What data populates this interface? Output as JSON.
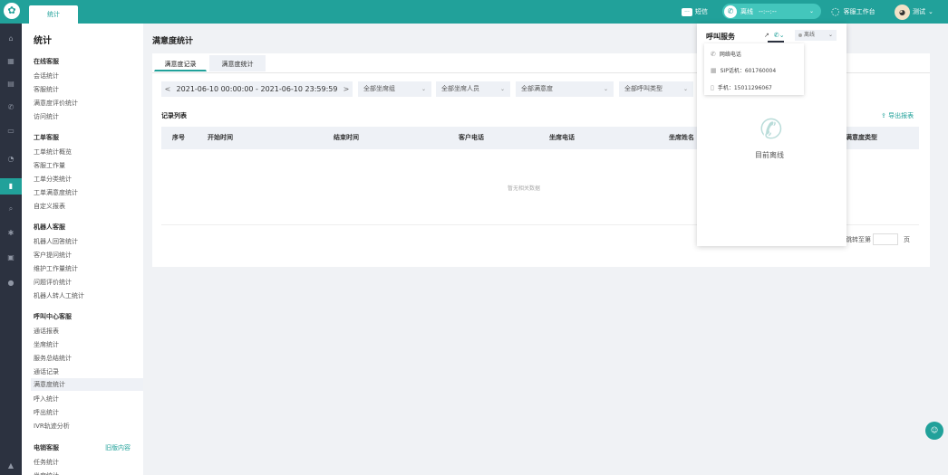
{
  "topbar": {
    "logo_glyph": "✿",
    "tab_label": "统计",
    "sms_label": "短信",
    "call_status": {
      "label": "离线",
      "timer": "--:--:--",
      "arrow": "⌄"
    },
    "workbench_label": "客服工作台",
    "user_name": "测试",
    "user_arrow": "⌄"
  },
  "rail": {
    "icons": [
      {
        "name": "home-icon",
        "glyph": "⌂"
      },
      {
        "name": "grid-icon",
        "glyph": "▦"
      },
      {
        "name": "file-icon",
        "glyph": "▤"
      },
      {
        "name": "phone-icon",
        "glyph": "✆"
      },
      {
        "name": "message-icon",
        "glyph": "▭"
      },
      {
        "name": "user-icon",
        "glyph": "◔"
      },
      {
        "name": "chart-icon",
        "glyph": "▮"
      },
      {
        "name": "search-icon",
        "glyph": "⌕"
      },
      {
        "name": "gear-icon",
        "glyph": "✱"
      },
      {
        "name": "mail-icon",
        "glyph": "▣"
      },
      {
        "name": "info-icon",
        "glyph": "●"
      },
      {
        "name": "bell-icon",
        "glyph": "▲"
      }
    ]
  },
  "nav": {
    "title": "统计",
    "groups": [
      {
        "label": "在线客服",
        "items": [
          "会话统计",
          "客服统计",
          "满意度评价统计",
          "访问统计"
        ]
      },
      {
        "label": "工单客服",
        "items": [
          "工单统计概览",
          "客服工作量",
          "工单分类统计",
          "工单满意度统计",
          "自定义报表"
        ]
      },
      {
        "label": "机器人客服",
        "items": [
          "机器人回答统计",
          "客户提问统计",
          "维护工作量统计",
          "问题评价统计",
          "机器人转人工统计"
        ]
      },
      {
        "label": "呼叫中心客服",
        "items": [
          "通话报表",
          "坐席统计",
          "服务总结统计",
          "通话记录",
          "满意度统计",
          "呼入统计",
          "呼出统计",
          "IVR轨迹分析"
        ]
      },
      {
        "label": "电销客服",
        "extra": "旧版内容",
        "items": [
          "任务统计",
          "坐席统计"
        ]
      }
    ],
    "active_item": "满意度统计"
  },
  "main": {
    "page_title": "满意度统计",
    "tabs": [
      "满意度记录",
      "满意度统计"
    ],
    "filters": {
      "date_range": "2021-06-10 00:00:00 - 2021-06-10 23:59:59",
      "prev": "<",
      "next": ">",
      "selects": [
        "全部坐席组",
        "全部坐席人员",
        "全部满意度",
        "全部呼叫类型"
      ]
    },
    "list_title": "记录列表",
    "export_label": "导出报表",
    "table": {
      "columns": [
        "序号",
        "开始时间",
        "结束时间",
        "客户电话",
        "坐席电话",
        "坐席姓名",
        "满意度类型"
      ],
      "empty_text": "暂无相关数据"
    },
    "pagination": {
      "jump_label": "跳转至第",
      "page_suffix": "页"
    }
  },
  "call_panel": {
    "title": "呼叫服务",
    "status_label": "离线",
    "options": [
      {
        "icon": "phone-icon",
        "label": "网络电话"
      },
      {
        "icon": "sip-icon",
        "label": "SIP话机：601760004"
      },
      {
        "icon": "mobile-icon",
        "label": "手机：15011296067"
      }
    ],
    "offline_text": "目前离线"
  },
  "floating": {
    "chat_glyph": "☺"
  },
  "colors": {
    "brand": "#21a19a",
    "rail": "#2c3240"
  }
}
